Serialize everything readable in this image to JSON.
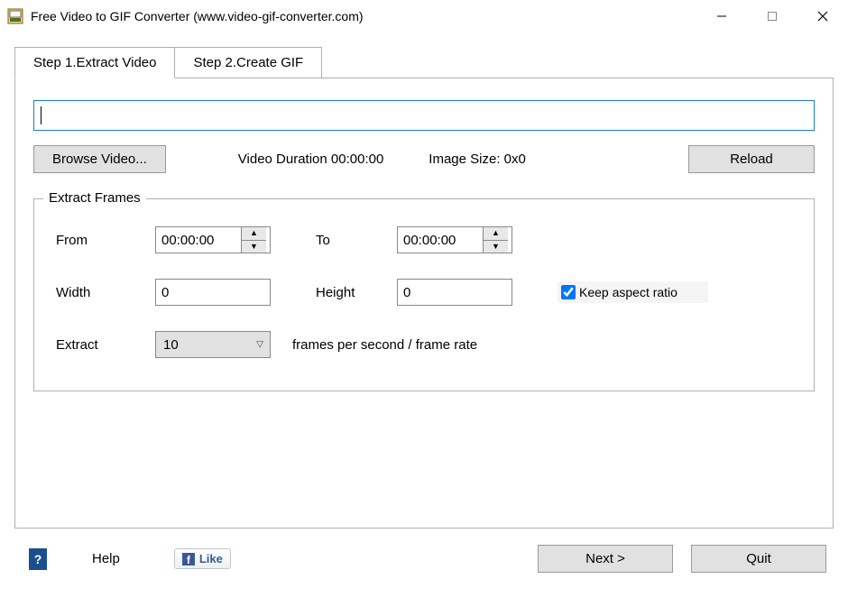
{
  "window": {
    "title": "Free Video to GIF Converter (www.video-gif-converter.com)"
  },
  "tabs": [
    {
      "label": "Step 1.Extract Video",
      "active": true
    },
    {
      "label": "Step 2.Create GIF",
      "active": false
    }
  ],
  "main": {
    "path_value": "",
    "browse_label": "Browse Video...",
    "duration_label": "Video Duration 00:00:00",
    "size_label": "Image Size: 0x0",
    "reload_label": "Reload"
  },
  "extract": {
    "legend": "Extract Frames",
    "from_label": "From",
    "from_value": "00:00:00",
    "to_label": "To",
    "to_value": "00:00:00",
    "width_label": "Width",
    "width_value": "0",
    "height_label": "Height",
    "height_value": "0",
    "keep_aspect_label": "Keep aspect ratio",
    "keep_aspect_checked": true,
    "extract_label": "Extract",
    "fps_value": "10",
    "fps_suffix": "frames per second / frame rate"
  },
  "footer": {
    "help_label": "Help",
    "like_label": "Like",
    "next_label": "Next >",
    "quit_label": "Quit"
  }
}
